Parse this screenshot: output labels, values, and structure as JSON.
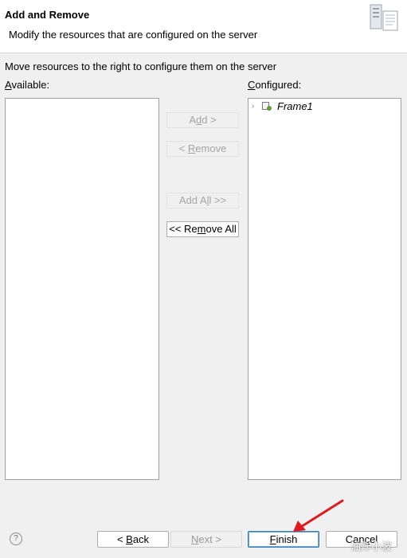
{
  "header": {
    "title": "Add and Remove",
    "description": "Modify the resources that are configured on the server",
    "banner_icon": "server-config-icon"
  },
  "instruction": "Move resources to the right to configure them on the server",
  "available": {
    "label_mnemonic": "A",
    "label_rest": "vailable:",
    "items": []
  },
  "configured": {
    "label_mnemonic": "C",
    "label_rest": "onfigured:",
    "items": [
      {
        "label": "Frame1",
        "icon": "project-icon"
      }
    ]
  },
  "buttons": {
    "add": {
      "pre": "A",
      "mn": "d",
      "post": "d >",
      "enabled": false
    },
    "remove": {
      "pre": "< ",
      "mn": "R",
      "post": "emove",
      "enabled": false
    },
    "add_all": {
      "pre": "Add A",
      "mn": "l",
      "post": "l >>",
      "enabled": false
    },
    "remove_all": {
      "pre": "<< Re",
      "mn": "m",
      "post": "ove All",
      "enabled": true
    }
  },
  "footer": {
    "help_icon": "?",
    "back": {
      "pre": "< ",
      "mn": "B",
      "post": "ack"
    },
    "next": {
      "pre": "",
      "mn": "N",
      "post": "ext >"
    },
    "finish": {
      "pre": "",
      "mn": "F",
      "post": "inish"
    },
    "cancel": {
      "pre": "Can",
      "mn": "c",
      "post": "el"
    }
  },
  "watermark": "油炸小波",
  "colors": {
    "annotation_arrow": "#e0191f",
    "default_button_border": "#3c7fb1"
  }
}
